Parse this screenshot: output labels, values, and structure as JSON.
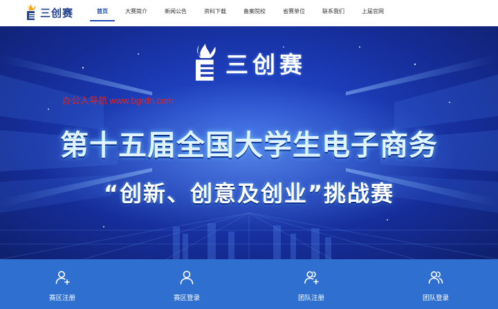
{
  "logo": {
    "text": "三创赛",
    "icon": "torch-logo-icon"
  },
  "nav": {
    "items": [
      {
        "label": "首页",
        "active": true
      },
      {
        "label": "大赛简介",
        "active": false
      },
      {
        "label": "新闻公告",
        "active": false
      },
      {
        "label": "资料下载",
        "active": false
      },
      {
        "label": "备案院校",
        "active": false
      },
      {
        "label": "省赛单位",
        "active": false
      },
      {
        "label": "联系我们",
        "active": false
      },
      {
        "label": "上届官网",
        "active": false
      }
    ]
  },
  "hero": {
    "logo_text": "三创赛",
    "watermark": "办公人导航 www.bgrdh.com",
    "title_line1": "第十五届全国大学生电子商务",
    "title_line2": "“创新、创意及创业”挑战赛"
  },
  "actions": [
    {
      "label": "赛区注册",
      "icon": "user-add-icon"
    },
    {
      "label": "赛区登录",
      "icon": "user-icon"
    },
    {
      "label": "团队注册",
      "icon": "team-add-icon"
    },
    {
      "label": "团队登录",
      "icon": "team-icon"
    }
  ],
  "colors": {
    "nav_active": "#1c4bb5",
    "action_bar": "#2f6fd0",
    "hero_bg": "#1c3cb8",
    "watermark": "#e8231c"
  }
}
